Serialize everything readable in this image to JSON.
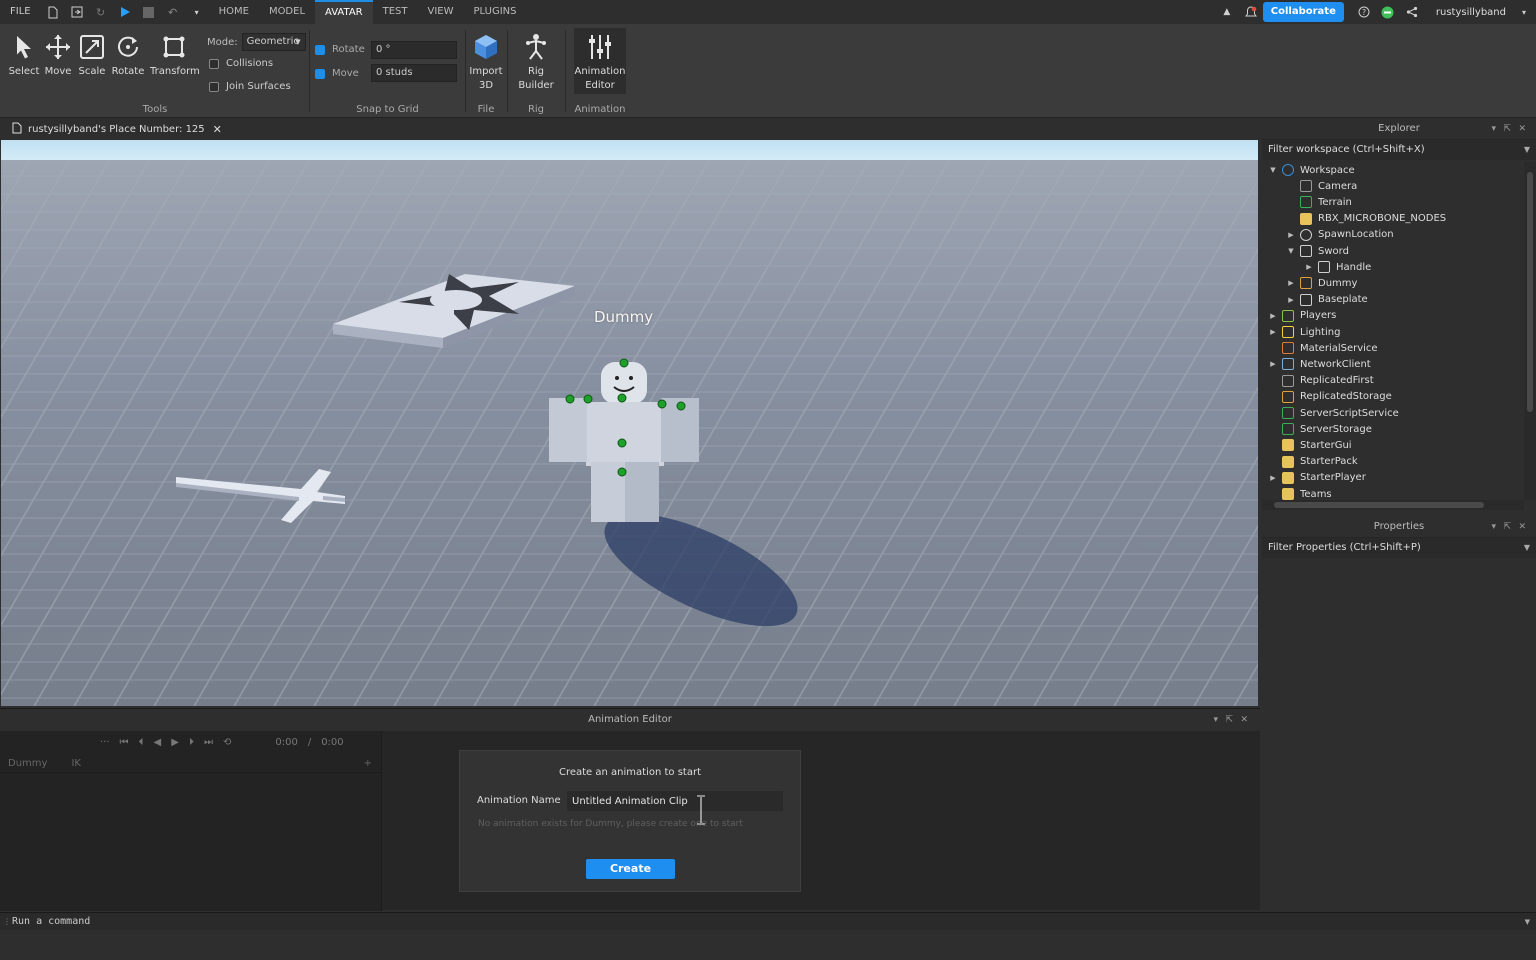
{
  "menu": {
    "file": "FILE",
    "tabs": [
      "HOME",
      "MODEL",
      "AVATAR",
      "TEST",
      "VIEW",
      "PLUGINS"
    ],
    "active_tab": "AVATAR",
    "collaborate": "Collaborate",
    "username": "rustysillyband"
  },
  "ribbon": {
    "tools": [
      "Select",
      "Move",
      "Scale",
      "Rotate",
      "Transform"
    ],
    "tools_group": "Tools",
    "mode_label": "Mode:",
    "mode_value": "Geometric",
    "collisions": "Collisions",
    "join_surfaces": "Join Surfaces",
    "rotate_label": "Rotate",
    "rotate_value": "0 °",
    "move_label": "Move",
    "move_value": "0 studs",
    "snap_group": "Snap to Grid",
    "import3d": [
      "Import",
      "3D"
    ],
    "file_group": "File",
    "rig_builder": [
      "Rig",
      "Builder"
    ],
    "rig_group": "Rig",
    "animation_editor": [
      "Animation",
      "Editor"
    ],
    "animation_group": "Animation"
  },
  "document_tab": "rustysillyband's Place Number: 125",
  "viewport": {
    "character_label": "Dummy"
  },
  "animation_editor": {
    "title": "Animation Editor",
    "time_current": "0:00",
    "time_sep": "/",
    "time_total": "0:00",
    "rig_name": "Dummy",
    "ik": "IK",
    "dialog_title": "Create an animation to start",
    "name_label": "Animation Name",
    "name_value": "Untitled Animation Clip",
    "hint": "No animation exists for Dummy, please create one to start",
    "create": "Create"
  },
  "command_bar": {
    "placeholder": "Run a command"
  },
  "explorer": {
    "title": "Explorer",
    "filter": "Filter workspace (Ctrl+Shift+X)",
    "items": [
      {
        "label": "Workspace",
        "indent": 0,
        "expander": "down",
        "icon": "workspace-icon",
        "color": "#3a8fd6"
      },
      {
        "label": "Camera",
        "indent": 1,
        "expander": "none",
        "icon": "camera-icon",
        "color": "#9a9a9a"
      },
      {
        "label": "Terrain",
        "indent": 1,
        "expander": "none",
        "icon": "terrain-icon",
        "color": "#3fae5a"
      },
      {
        "label": "RBX_MICROBONE_NODES",
        "indent": 1,
        "expander": "none",
        "icon": "folder-icon",
        "color": "#e8c25a"
      },
      {
        "label": "SpawnLocation",
        "indent": 1,
        "expander": "right",
        "icon": "spawn-location-icon",
        "color": "#cfcfcf"
      },
      {
        "label": "Sword",
        "indent": 1,
        "expander": "down",
        "icon": "tool-icon",
        "color": "#cfcfcf"
      },
      {
        "label": "Handle",
        "indent": 2,
        "expander": "right",
        "icon": "part-icon",
        "color": "#cfcfcf"
      },
      {
        "label": "Dummy",
        "indent": 1,
        "expander": "right",
        "icon": "model-icon",
        "color": "#e0a040"
      },
      {
        "label": "Baseplate",
        "indent": 1,
        "expander": "right",
        "icon": "part-icon",
        "color": "#cfcfcf"
      },
      {
        "label": "Players",
        "indent": 0,
        "expander": "right",
        "icon": "players-icon",
        "color": "#8bc34a"
      },
      {
        "label": "Lighting",
        "indent": 0,
        "expander": "right",
        "icon": "lighting-icon",
        "color": "#f5d23a"
      },
      {
        "label": "MaterialService",
        "indent": 0,
        "expander": "none",
        "icon": "material-service-icon",
        "color": "#e07a3a"
      },
      {
        "label": "NetworkClient",
        "indent": 0,
        "expander": "right",
        "icon": "network-client-icon",
        "color": "#7ab0d8"
      },
      {
        "label": "ReplicatedFirst",
        "indent": 0,
        "expander": "none",
        "icon": "replicated-first-icon",
        "color": "#9a9a9a"
      },
      {
        "label": "ReplicatedStorage",
        "indent": 0,
        "expander": "none",
        "icon": "replicated-storage-icon",
        "color": "#e0a040"
      },
      {
        "label": "ServerScriptService",
        "indent": 0,
        "expander": "none",
        "icon": "server-script-service-icon",
        "color": "#3fae5a"
      },
      {
        "label": "ServerStorage",
        "indent": 0,
        "expander": "none",
        "icon": "server-storage-icon",
        "color": "#3fae5a"
      },
      {
        "label": "StarterGui",
        "indent": 0,
        "expander": "none",
        "icon": "starter-gui-icon",
        "color": "#e8c25a"
      },
      {
        "label": "StarterPack",
        "indent": 0,
        "expander": "none",
        "icon": "starter-pack-icon",
        "color": "#e8c25a"
      },
      {
        "label": "StarterPlayer",
        "indent": 0,
        "expander": "right",
        "icon": "starter-player-icon",
        "color": "#e8c25a"
      },
      {
        "label": "Teams",
        "indent": 0,
        "expander": "none",
        "icon": "teams-icon",
        "color": "#e8c25a"
      }
    ]
  },
  "properties": {
    "title": "Properties",
    "filter": "Filter Properties (Ctrl+Shift+P)"
  },
  "colors": {
    "accent": "#1f8ef1",
    "panel": "#2e2e2e",
    "ribbon": "#3b3b3b"
  }
}
